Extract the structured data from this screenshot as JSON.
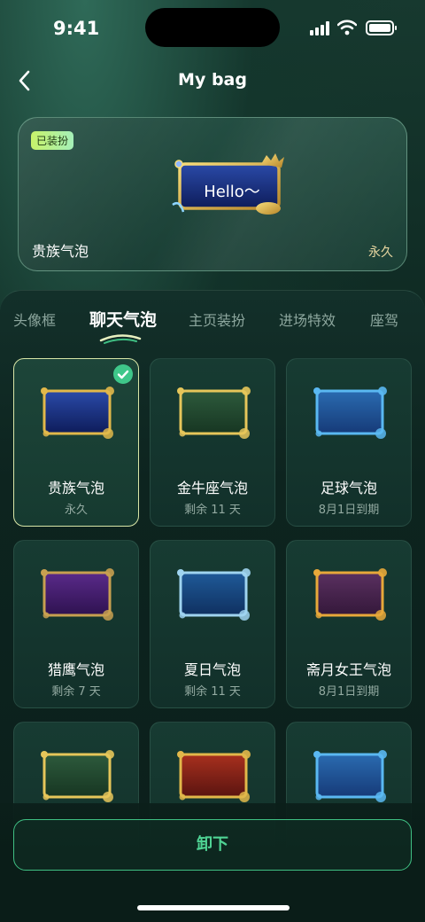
{
  "status_bar": {
    "time": "9:41"
  },
  "nav": {
    "title": "My bag"
  },
  "preview": {
    "badge": "已装扮",
    "bubble_text": "Hello～",
    "name": "贵族气泡",
    "duration": "永久"
  },
  "tabs": [
    {
      "label": "头像框",
      "active": false
    },
    {
      "label": "聊天气泡",
      "active": true
    },
    {
      "label": "主页装扮",
      "active": false
    },
    {
      "label": "进场特效",
      "active": false
    },
    {
      "label": "座驾",
      "active": false
    }
  ],
  "items": [
    {
      "name": "贵族气泡",
      "meta": "永久",
      "selected": true,
      "style": "noble"
    },
    {
      "name": "金牛座气泡",
      "meta": "剩余 11 天",
      "selected": false,
      "style": "taurus"
    },
    {
      "name": "足球气泡",
      "meta": "8月1日到期",
      "selected": false,
      "style": "football"
    },
    {
      "name": "猎鹰气泡",
      "meta": "剩余 7 天",
      "selected": false,
      "style": "falcon"
    },
    {
      "name": "夏日气泡",
      "meta": "剩余 11 天",
      "selected": false,
      "style": "summer"
    },
    {
      "name": "斋月女王气泡",
      "meta": "8月1日到期",
      "selected": false,
      "style": "queen"
    },
    {
      "name": "",
      "meta": "",
      "selected": false,
      "style": "taurus"
    },
    {
      "name": "",
      "meta": "",
      "selected": false,
      "style": "red"
    },
    {
      "name": "",
      "meta": "",
      "selected": false,
      "style": "football"
    }
  ],
  "action": {
    "unequip_label": "卸下"
  },
  "colors": {
    "accent_green": "#4fd394",
    "check_green": "#3fc78a",
    "gold": "#e2b84a",
    "selected_border": "#d9e6a7"
  }
}
